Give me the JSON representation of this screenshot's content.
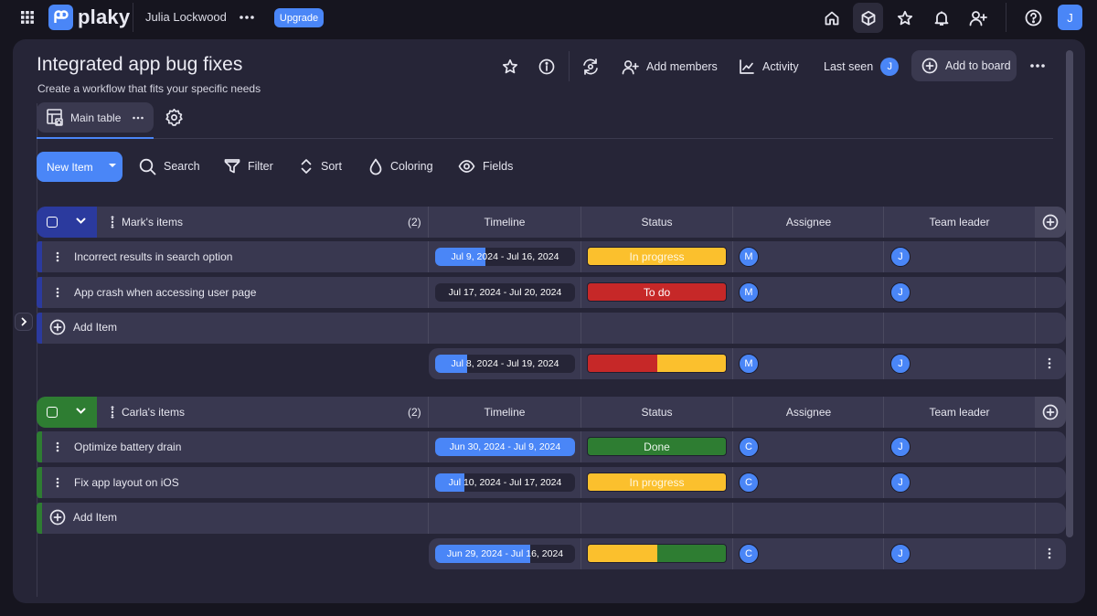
{
  "topbar": {
    "logo_text": "plaky",
    "workspace": "Julia Lockwood",
    "upgrade_label": "Upgrade",
    "user_initial": "J",
    "icons": [
      "apps-grid-icon",
      "home-icon",
      "boards-cube-icon",
      "favorites-star-icon",
      "notifications-bell-icon",
      "invite-user-icon",
      "help-icon"
    ]
  },
  "board": {
    "title": "Integrated app bug fixes",
    "description": "Create a workflow that fits your specific needs",
    "actions": {
      "add_members": "Add members",
      "activity": "Activity",
      "last_seen": "Last seen",
      "last_seen_initial": "J",
      "add_to_board": "Add to board"
    },
    "view_tab": "Main table"
  },
  "toolbar": {
    "new_item": "New Item",
    "search": "Search",
    "filter": "Filter",
    "sort": "Sort",
    "coloring": "Coloring",
    "fields": "Fields"
  },
  "columns": [
    "Timeline",
    "Status",
    "Assignee",
    "Team leader"
  ],
  "colors": {
    "accent": "#4a86f7",
    "group_mark": "#2b3a9e",
    "group_carla": "#2e7d32",
    "in_progress": "#fbc02d",
    "to_do": "#c62828",
    "done": "#2e7d32"
  },
  "add_item_label": "Add Item",
  "groups": [
    {
      "name": "Mark's items",
      "count": "(2)",
      "items": [
        {
          "name": "Incorrect results in search option",
          "timeline": "Jul 9, 2024 - Jul 16, 2024",
          "timeline_progress": 0.36,
          "status": "In progress",
          "assignee": "M",
          "leader": "J"
        },
        {
          "name": "App crash when accessing user page",
          "timeline": "Jul 17, 2024 - Jul 20, 2024",
          "timeline_progress": 0,
          "status": "To do",
          "assignee": "M",
          "leader": "J"
        }
      ],
      "summary": {
        "timeline": "Jul 8, 2024 - Jul 19, 2024",
        "timeline_progress": 0.23,
        "status_split": [
          {
            "status": "To do",
            "fraction": 0.5
          },
          {
            "status": "In progress",
            "fraction": 0.5
          }
        ],
        "assignee": "M",
        "leader": "J"
      }
    },
    {
      "name": "Carla's items",
      "count": "(2)",
      "items": [
        {
          "name": "Optimize battery drain",
          "timeline": "Jun 30, 2024 - Jul 9, 2024",
          "timeline_progress": 1,
          "status": "Done",
          "assignee": "C",
          "leader": "J"
        },
        {
          "name": "Fix app layout on iOS",
          "timeline": "Jul 10, 2024 - Jul 17, 2024",
          "timeline_progress": 0.21,
          "status": "In progress",
          "assignee": "C",
          "leader": "J"
        }
      ],
      "summary": {
        "timeline": "Jun 29, 2024 - Jul 16, 2024",
        "timeline_progress": 0.68,
        "status_split": [
          {
            "status": "In progress",
            "fraction": 0.5
          },
          {
            "status": "Done",
            "fraction": 0.5
          }
        ],
        "assignee": "C",
        "leader": "J"
      }
    }
  ]
}
